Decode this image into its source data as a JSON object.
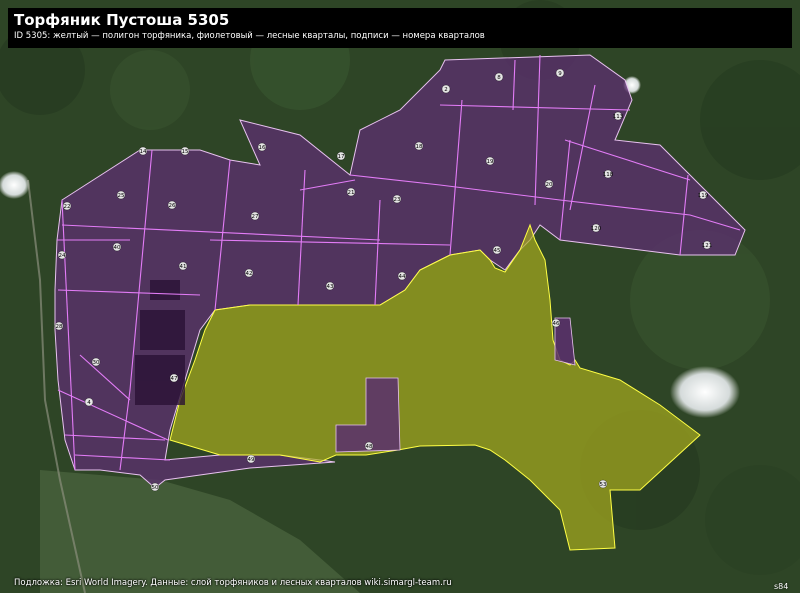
{
  "map": {
    "title": "Торфяник Пустоша 5305",
    "subtitle": "ID 5305: желтый — полигон торфяника, фиолетовый — лесные кварталы, подписи — номера кварталов",
    "attribution": "Подложка: Esri World Imagery. Данные: слой торфяников и лесных кварталов wiki.simargl-team.ru",
    "corner_label": "s84",
    "colors": {
      "peat_fill": "#a8ad1e",
      "peat_outline": "#ffff44",
      "quarter_fill": "#5b2f6e",
      "quarter_lines": "#e37cf7",
      "forest": "#304a28",
      "title_bg": "#000000"
    },
    "quarter_labels": [
      "2",
      "8",
      "9",
      "113",
      "14",
      "15",
      "16",
      "17",
      "18",
      "19",
      "20",
      "21",
      "22",
      "23",
      "24",
      "25",
      "26",
      "27",
      "28",
      "30",
      "40",
      "41",
      "42",
      "43",
      "44",
      "45",
      "46",
      "47",
      "48",
      "49",
      "50",
      "53",
      "54",
      "58",
      "64",
      "118",
      "119",
      "120",
      "121",
      "122"
    ]
  }
}
